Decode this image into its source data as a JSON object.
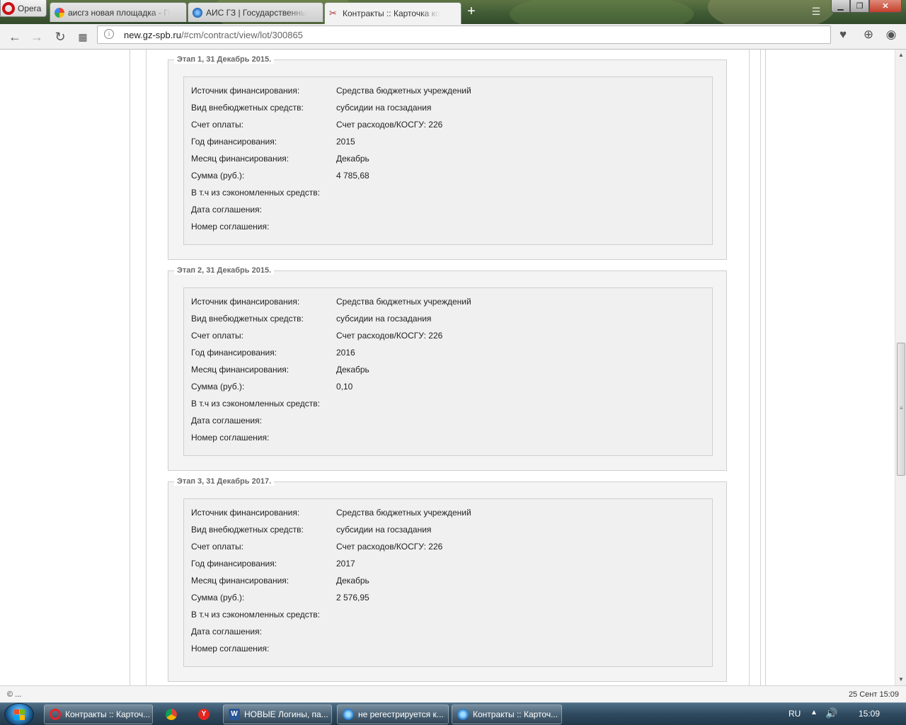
{
  "browser": {
    "app_name": "Opera",
    "tabs": [
      {
        "label": "аисгз новая площадка - П",
        "icon": "google-icon"
      },
      {
        "label": "АИС ГЗ | Государственны",
        "icon": "ais-icon"
      },
      {
        "label": "Контракты :: Карточка ко",
        "icon": "tools-icon",
        "active": true
      }
    ],
    "url_host": "new.gz-spb.ru",
    "url_path": "/#cm/contract/view/lot/300865"
  },
  "stages": [
    {
      "title": "Этап 1, 31 Декабрь 2015.",
      "rows": [
        {
          "label": "Источник финансирования:",
          "value": "Средства бюджетных учреждений"
        },
        {
          "label": "Вид внебюджетных средств:",
          "value": "субсидии на госзадания"
        },
        {
          "label": "Счет оплаты:",
          "value": "Счет расходов/КОСГУ: 226"
        },
        {
          "label": "Год финансирования:",
          "value": "2015"
        },
        {
          "label": "Месяц финансирования:",
          "value": "Декабрь"
        },
        {
          "label": "Сумма (руб.):",
          "value": "4 785,68"
        },
        {
          "label": "В т.ч из сэкономленных средств:",
          "value": ""
        },
        {
          "label": "Дата соглашения:",
          "value": ""
        },
        {
          "label": "Номер соглашения:",
          "value": ""
        }
      ]
    },
    {
      "title": "Этап 2, 31 Декабрь 2015.",
      "rows": [
        {
          "label": "Источник финансирования:",
          "value": "Средства бюджетных учреждений"
        },
        {
          "label": "Вид внебюджетных средств:",
          "value": "субсидии на госзадания"
        },
        {
          "label": "Счет оплаты:",
          "value": "Счет расходов/КОСГУ: 226"
        },
        {
          "label": "Год финансирования:",
          "value": "2016"
        },
        {
          "label": "Месяц финансирования:",
          "value": "Декабрь"
        },
        {
          "label": "Сумма (руб.):",
          "value": "0,10"
        },
        {
          "label": "В т.ч из сэкономленных средств:",
          "value": ""
        },
        {
          "label": "Дата соглашения:",
          "value": ""
        },
        {
          "label": "Номер соглашения:",
          "value": ""
        }
      ]
    },
    {
      "title": "Этап 3, 31 Декабрь 2017.",
      "rows": [
        {
          "label": "Источник финансирования:",
          "value": "Средства бюджетных учреждений"
        },
        {
          "label": "Вид внебюджетных средств:",
          "value": "субсидии на госзадания"
        },
        {
          "label": "Счет оплаты:",
          "value": "Счет расходов/КОСГУ: 226"
        },
        {
          "label": "Год финансирования:",
          "value": "2017"
        },
        {
          "label": "Месяц финансирования:",
          "value": "Декабрь"
        },
        {
          "label": "Сумма (руб.):",
          "value": "2 576,95"
        },
        {
          "label": "В т.ч из сэкономленных средств:",
          "value": ""
        },
        {
          "label": "Дата соглашения:",
          "value": ""
        },
        {
          "label": "Номер соглашения:",
          "value": ""
        }
      ]
    }
  ],
  "statusbar": {
    "left": "© ...",
    "right": "25 Сент 15:09"
  },
  "taskbar": {
    "items": [
      {
        "label": "Контракты :: Карточ...",
        "icon": "opera-icon"
      },
      {
        "label": "",
        "icon": "chrome-icon"
      },
      {
        "label": "",
        "icon": "yandex-icon"
      },
      {
        "label": "НОВЫЕ Логины, па...",
        "icon": "word-icon"
      },
      {
        "label": "не регестрируется к...",
        "icon": "ie-icon"
      },
      {
        "label": "Контракты :: Карточ...",
        "icon": "ie-icon"
      }
    ],
    "lang": "RU",
    "clock": "15:09"
  },
  "colors": {
    "tabstrip": "#3e5a34",
    "stage_bg": "#f0f0f0",
    "border": "#cfcfcf",
    "taskbar": "#2f4a5f",
    "opera_red": "#cc0f16"
  }
}
